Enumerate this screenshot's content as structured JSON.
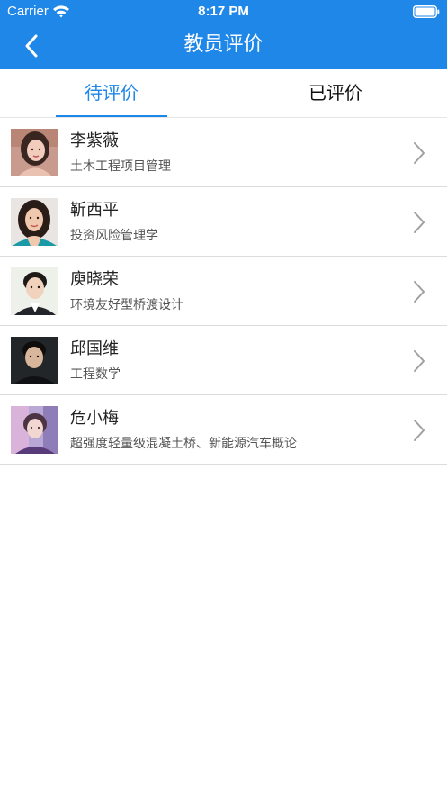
{
  "status_bar": {
    "carrier": "Carrier",
    "time": "8:17 PM"
  },
  "nav": {
    "title": "教员评价"
  },
  "tabs": [
    {
      "label": "待评价",
      "active": true
    },
    {
      "label": "已评价",
      "active": false
    }
  ],
  "teachers": [
    {
      "name": "李紫薇",
      "course": "土木工程项目管理"
    },
    {
      "name": "靳西平",
      "course": "投资风险管理学"
    },
    {
      "name": "庾晓荣",
      "course": "环境友好型桥渡设计"
    },
    {
      "name": "邱国维",
      "course": "工程数学"
    },
    {
      "name": "危小梅",
      "course": "超强度轻量级混凝土桥、新能源汽车概论"
    }
  ],
  "colors": {
    "brand": "#1f87e8",
    "divider": "#dcdcdc"
  }
}
